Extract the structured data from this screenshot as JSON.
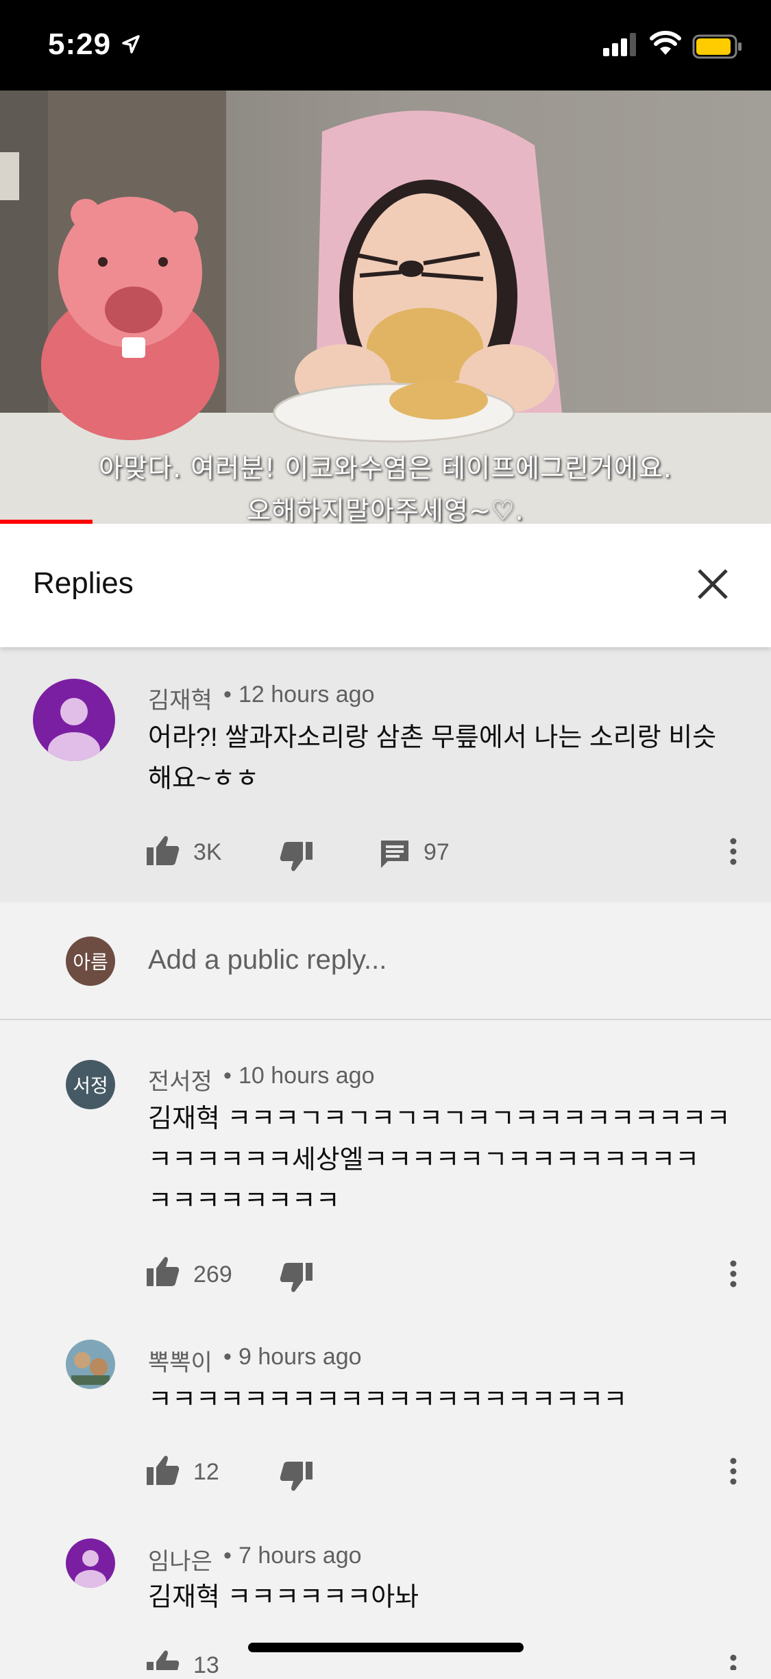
{
  "status_bar": {
    "time": "5:29"
  },
  "video": {
    "subtitle_line1": "아맞다. 여러분! 이코와수염은 테이프에그린거에요.",
    "subtitle_line2": "오해하지말아주세영~♡.",
    "progress_fraction": 0.12
  },
  "panel": {
    "title": "Replies"
  },
  "original_comment": {
    "author": "김재혁",
    "time": "12 hours ago",
    "text_line1": "어라?! 쌀과자소리랑 삼촌 무릎에서 나는 소리랑 비슷",
    "text_line2": "해요~ㅎㅎ",
    "likes": "3K",
    "replies": "97",
    "avatar_color": "#7b1fa2"
  },
  "reply_input": {
    "avatar_text": "아름",
    "avatar_color": "#6d4c41",
    "placeholder": "Add a public reply..."
  },
  "replies": [
    {
      "author": "전서정",
      "time": "10 hours ago",
      "avatar_text": "서정",
      "avatar_color": "#455a64",
      "text_line1": "김재혁 ㅋㅋㅋㄱㅋㄱㅋㄱㅋㄱㅋㄱㅋㅋㅋㅋㅋㅋㅋㅋㅋ",
      "text_line2": "ㅋㅋㅋㅋㅋㅋ세상엘ㅋㅋㅋㅋㅋㄱㅋㅋㅋㅋㅋㅋㅋㅋ",
      "text_line3": "ㅋㅋㅋㅋㅋㅋㅋㅋ",
      "likes": "269"
    },
    {
      "author": "뽁뽁이",
      "time": "9 hours ago",
      "text_line1": "ㅋㅋㅋㅋㅋㅋㅋㅋㅋㅋㅋㅋㅋㅋㅋㅋㅋㅋㅋㅋ",
      "likes": "12"
    },
    {
      "author": "임나은",
      "time": "7 hours ago",
      "avatar_color": "#7b1fa2",
      "text_line1": "김재혁 ㅋㅋㅋㅋㅋㅋ아놔",
      "likes": "13"
    }
  ]
}
